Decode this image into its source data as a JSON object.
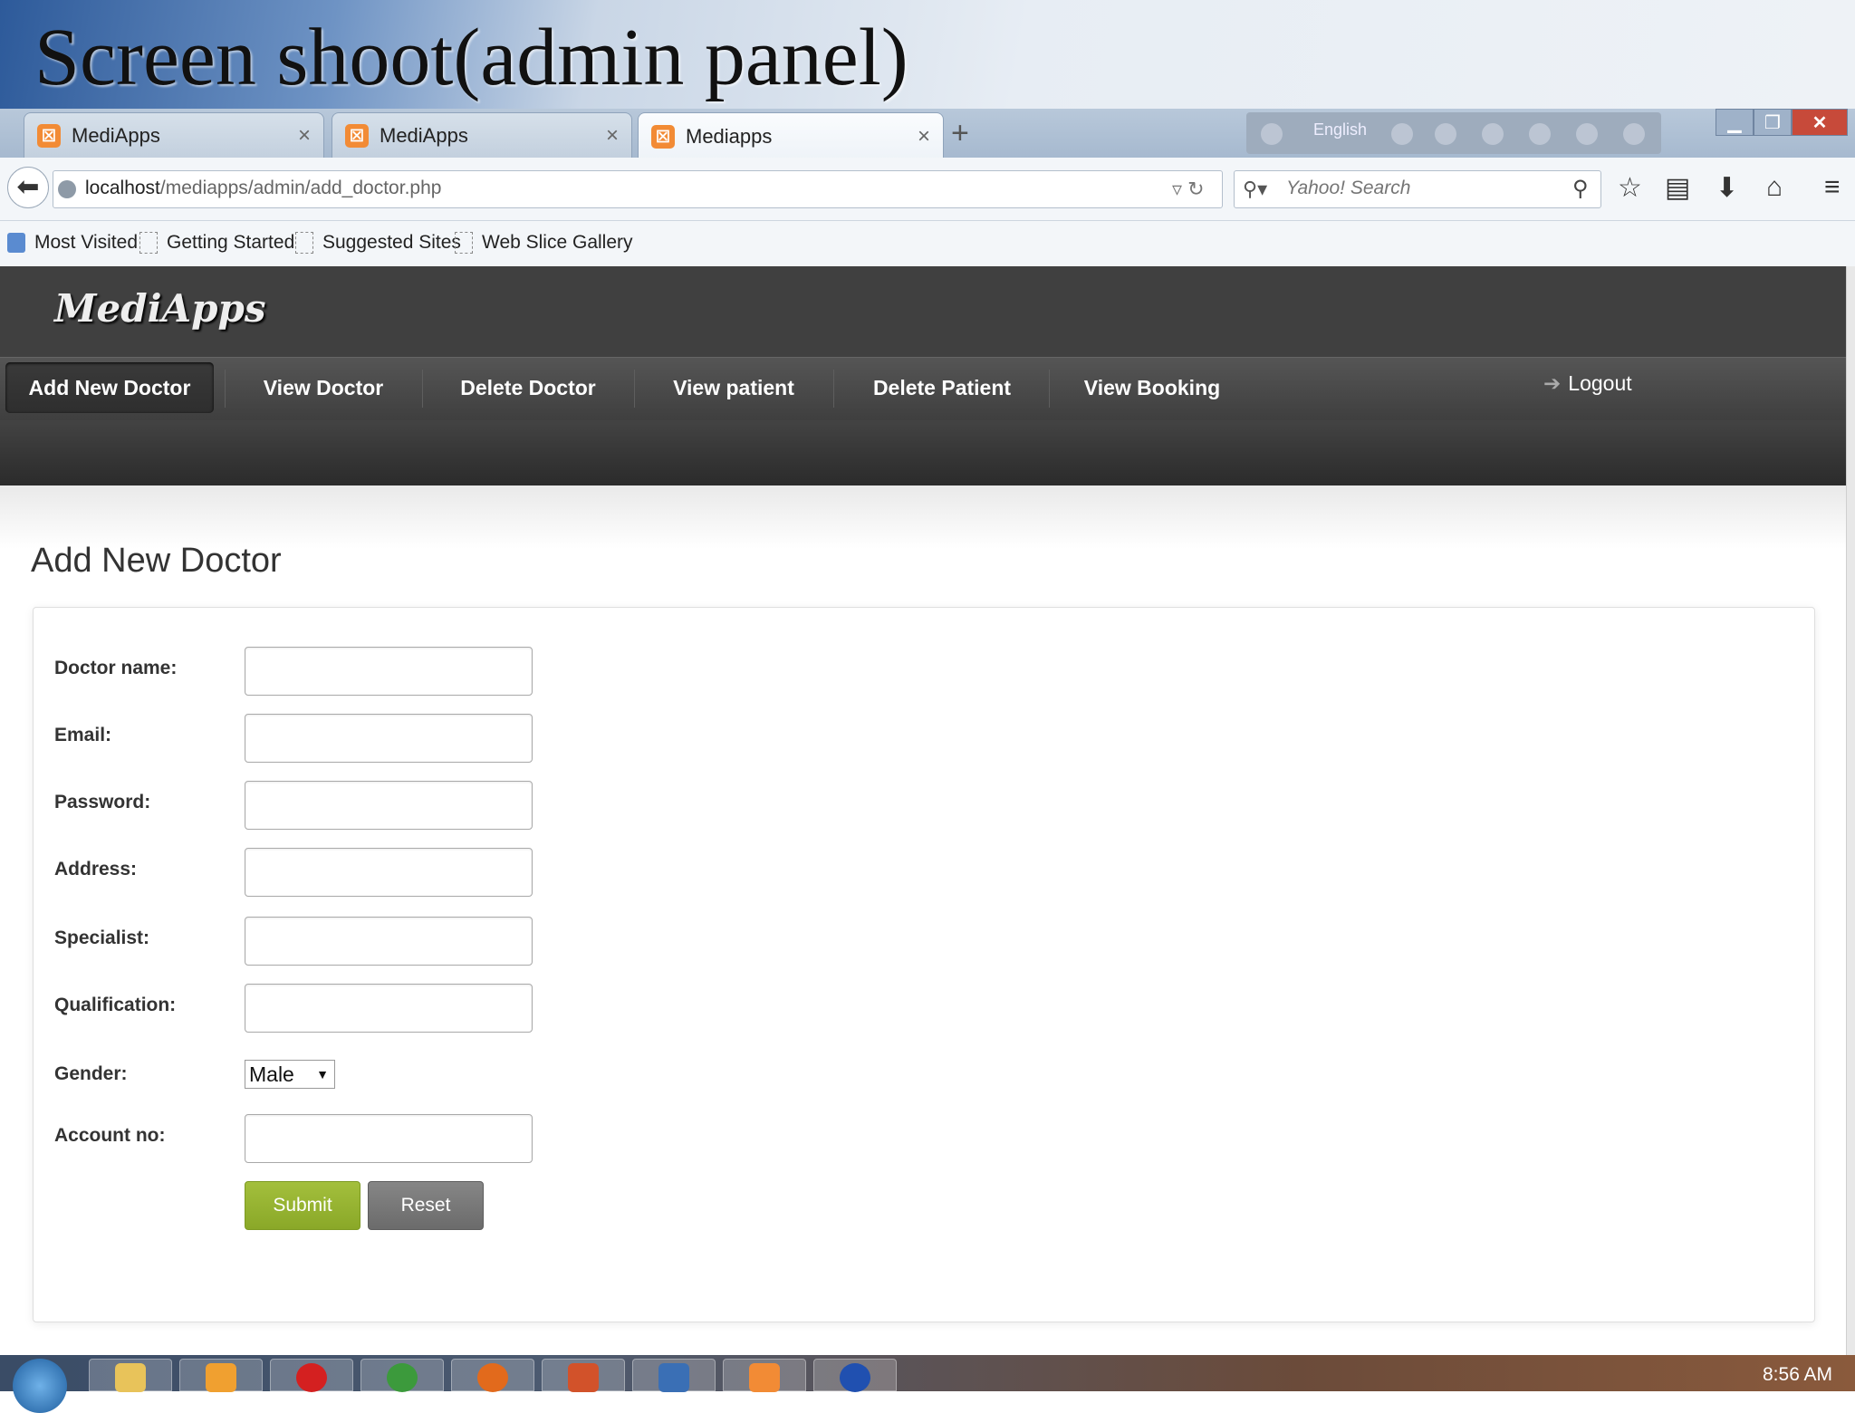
{
  "slide": {
    "title": "Screen shoot(admin panel)"
  },
  "browser": {
    "tabs": [
      {
        "label": "MediApps",
        "active": false
      },
      {
        "label": "MediApps",
        "active": false
      },
      {
        "label": "Mediapps",
        "active": true
      }
    ],
    "tab_close_glyph": "×",
    "new_tab_glyph": "+",
    "language": "English",
    "url_host": "localhost",
    "url_path": "/mediapps/admin/add_doctor.php",
    "search_placeholder": "Yahoo! Search",
    "bookmarks": [
      "Most Visited",
      "Getting Started",
      "Suggested Sites",
      "Web Slice Gallery"
    ]
  },
  "site": {
    "logo": "MediApps",
    "menu": [
      "Add New Doctor",
      "View Doctor",
      "Delete Doctor",
      "View patient",
      "Delete Patient",
      "View Booking"
    ],
    "active_menu": "Add New Doctor",
    "logout": "Logout"
  },
  "form": {
    "heading": "Add New Doctor",
    "fields": [
      {
        "label": "Doctor name:",
        "value": ""
      },
      {
        "label": "Email:",
        "value": ""
      },
      {
        "label": "Password:",
        "value": ""
      },
      {
        "label": "Address:",
        "value": ""
      },
      {
        "label": "Specialist:",
        "value": ""
      },
      {
        "label": "Qualification:",
        "value": ""
      }
    ],
    "gender": {
      "label": "Gender:",
      "selected": "Male"
    },
    "account": {
      "label": "Account no:",
      "value": ""
    },
    "submit_label": "Submit",
    "reset_label": "Reset"
  },
  "taskbar": {
    "clock": "8:56 AM"
  },
  "colors": {
    "submit": "#8aa828",
    "reset": "#6b6b6b",
    "header": "#404040",
    "accent_tab": "#f28b35"
  },
  "icons": [
    "back-arrow-icon",
    "globe-icon",
    "refresh-icon",
    "search-icon",
    "star-icon",
    "clipboard-icon",
    "download-icon",
    "home-icon",
    "menu-icon",
    "logout-arrow-icon",
    "dropdown-caret-icon"
  ]
}
